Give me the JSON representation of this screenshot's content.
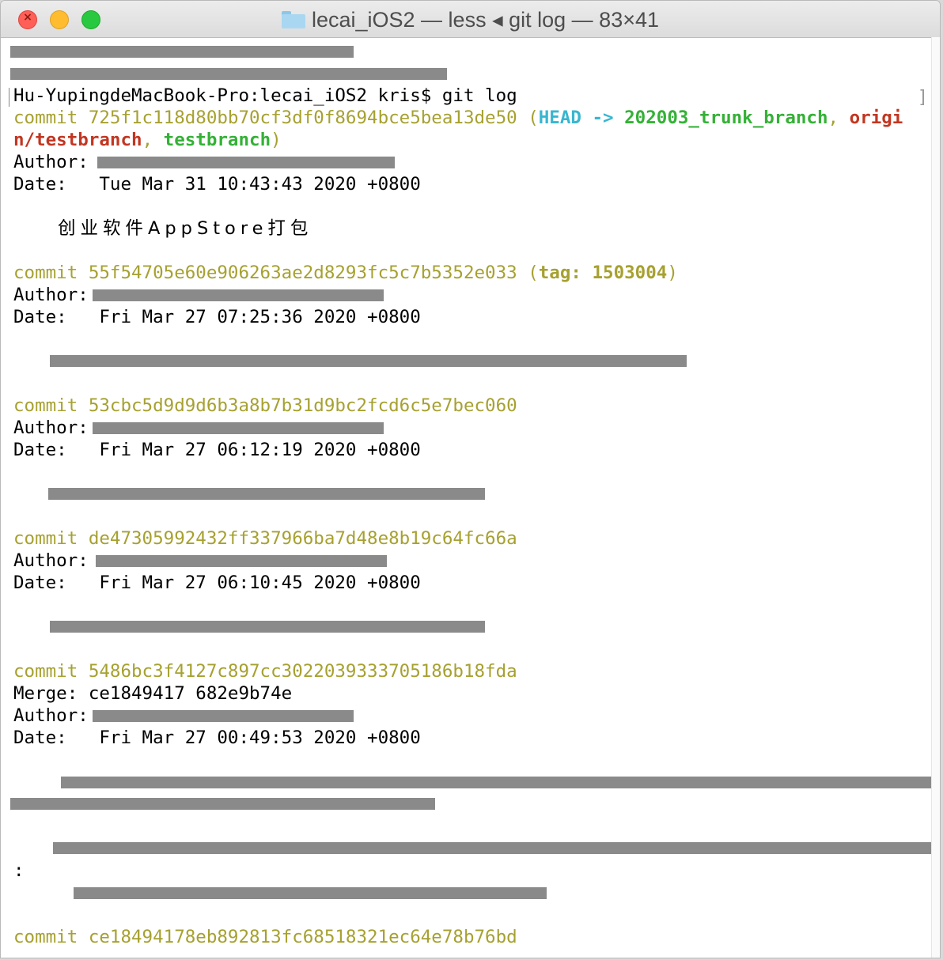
{
  "window": {
    "title": "lecai_iOS2 — less ◂ git log — 83×41",
    "folder_icon": "folder-icon"
  },
  "terminal": {
    "prompt": "Hu-YupingdeMacBook-Pro:lecai_iOS2 kris$ git log",
    "commit1": {
      "hash": "commit 725f1c118d80bb70cf3df0f8694bce5bea13de50",
      "open": " (",
      "head": "HEAD -> ",
      "branch": "202003_trunk_branch",
      "sep1": ", ",
      "origin_a": "origi",
      "origin_b": "n/testbranch",
      "sep2": ", ",
      "local": "testbranch",
      "close": ")",
      "author_label": "Author:",
      "date": "Date:   Tue Mar 31 10:43:43 2020 +0800",
      "message": "创业软件AppStore打包"
    },
    "commit2": {
      "hash": "commit 55f54705e60e906263ae2d8293fc5c7b5352e033",
      "open": " (",
      "tag": "tag: 1503004",
      "close": ")",
      "author_label": "Author:",
      "date": "Date:   Fri Mar 27 07:25:36 2020 +0800"
    },
    "commit3": {
      "hash": "commit 53cbc5d9d9d6b3a8b7b31d9bc2fcd6c5e7bec060",
      "author_label": "Author:",
      "date": "Date:   Fri Mar 27 06:12:19 2020 +0800"
    },
    "commit4": {
      "hash": "commit de47305992432ff337966ba7d48e8b19c64fc66a",
      "author_label": "Author:",
      "date": "Date:   Fri Mar 27 06:10:45 2020 +0800"
    },
    "commit5": {
      "hash": "commit 5486bc3f4127c897cc3022039333705186b18fda",
      "merge": "Merge: ce1849417 682e9b74e",
      "author_label": "Author:",
      "date": "Date:   Fri Mar 27 00:49:53 2020 +0800",
      "colon": ":"
    },
    "commit6": {
      "hash": "commit ce18494178eb892813fc68518321ec64e78b76bd"
    }
  }
}
